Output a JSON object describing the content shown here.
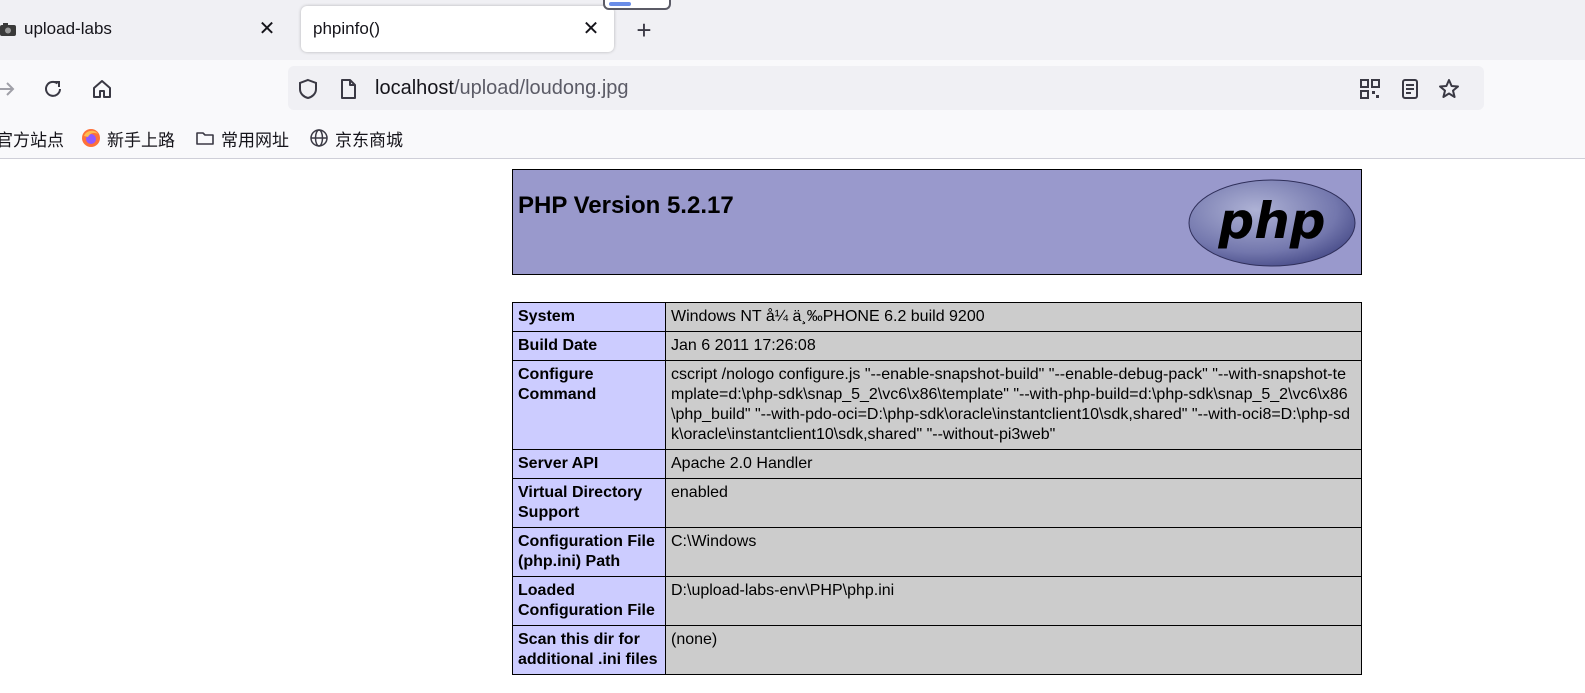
{
  "tabs": [
    {
      "label": "upload-labs",
      "active": false,
      "icon": "app-favicon-icon"
    },
    {
      "label": "phpinfo()",
      "active": true
    }
  ],
  "address": {
    "host": "localhost",
    "path": "/upload/loudong.jpg"
  },
  "bookmarks": [
    {
      "label": "官方站点",
      "icon": "none"
    },
    {
      "label": "新手上路",
      "icon": "firefox-icon"
    },
    {
      "label": "常用网址",
      "icon": "folder-icon"
    },
    {
      "label": "京东商城",
      "icon": "globe-icon"
    }
  ],
  "php": {
    "version_title": "PHP Version 5.2.17",
    "logo_text": "php",
    "rows": [
      {
        "key": "System",
        "value": "Windows NT å¼ ä¸‰PHONE 6.2 build 9200"
      },
      {
        "key": "Build Date",
        "value": "Jan 6 2011 17:26:08"
      },
      {
        "key": "Configure Command",
        "value": "cscript /nologo configure.js \"--enable-snapshot-build\" \"--enable-debug-pack\" \"--with-snapshot-template=d:\\php-sdk\\snap_5_2\\vc6\\x86\\template\" \"--with-php-build=d:\\php-sdk\\snap_5_2\\vc6\\x86\\php_build\" \"--with-pdo-oci=D:\\php-sdk\\oracle\\instantclient10\\sdk,shared\" \"--with-oci8=D:\\php-sdk\\oracle\\instantclient10\\sdk,shared\" \"--without-pi3web\""
      },
      {
        "key": "Server API",
        "value": "Apache 2.0 Handler"
      },
      {
        "key": "Virtual Directory Support",
        "value": "enabled"
      },
      {
        "key": "Configuration File (php.ini) Path",
        "value": "C:\\Windows"
      },
      {
        "key": "Loaded Configuration File",
        "value": "D:\\upload-labs-env\\PHP\\php.ini"
      },
      {
        "key": "Scan this dir for additional .ini files",
        "value": "(none)"
      }
    ]
  },
  "colors": {
    "header_bg": "#9999cc",
    "key_bg": "#ccccff",
    "value_bg": "#cccccc"
  }
}
